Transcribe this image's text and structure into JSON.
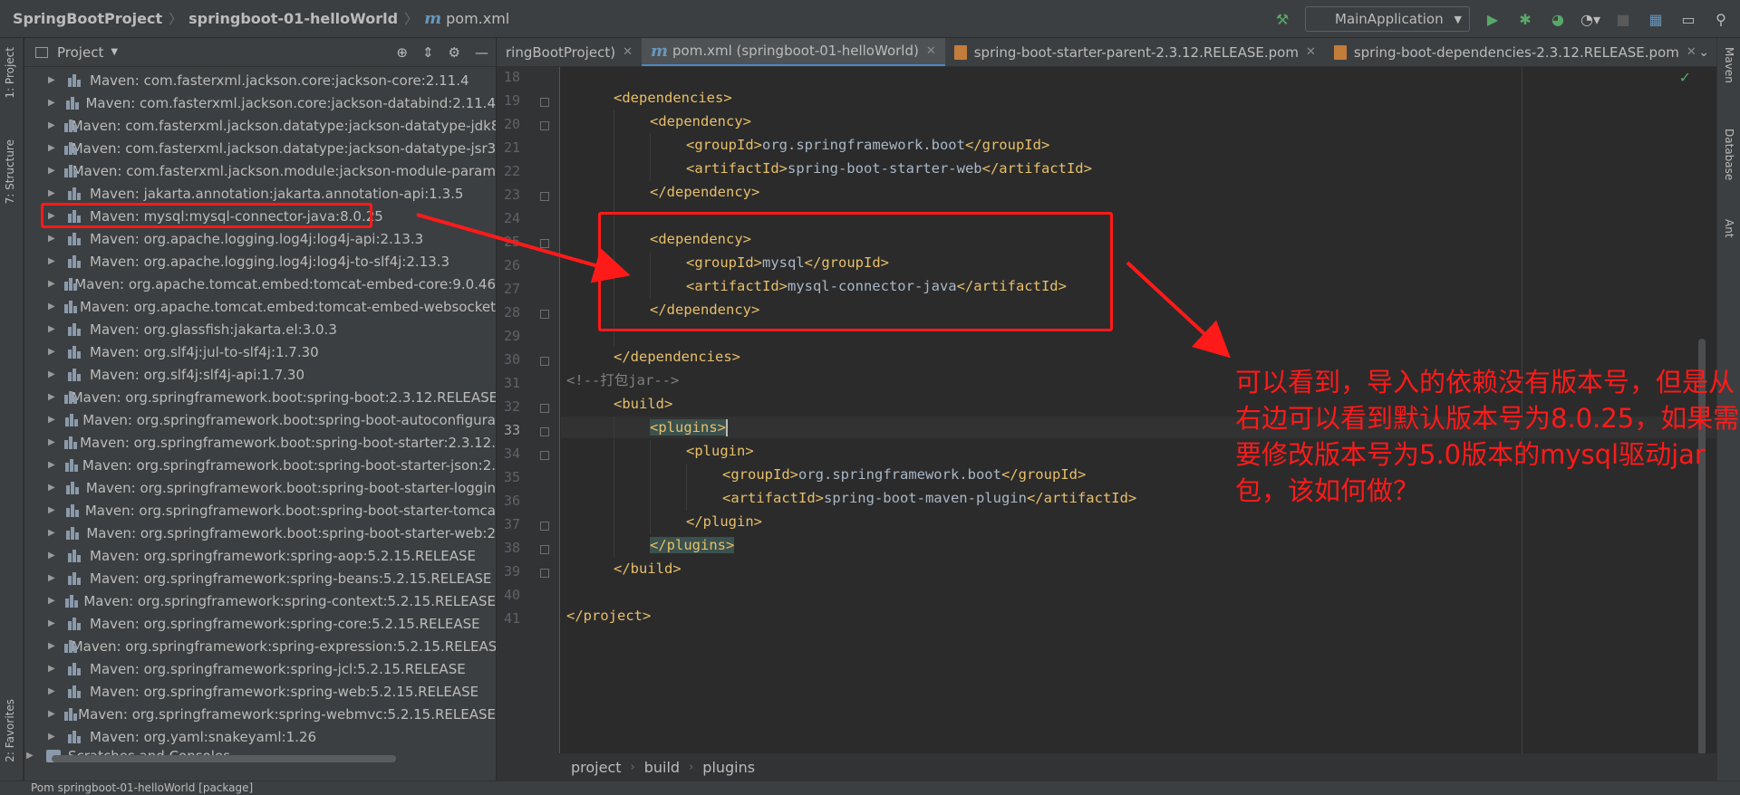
{
  "breadcrumb": {
    "project": "SpringBootProject",
    "module": "springboot-01-helloWorld",
    "file": "pom.xml"
  },
  "toolbar": {
    "run_config": "MainApplication"
  },
  "left_tabs": {
    "project": "1: Project",
    "structure": "7: Structure",
    "favorites": "2: Favorites"
  },
  "right_tabs": {
    "maven": "Maven",
    "database": "Database",
    "ant": "Ant"
  },
  "project_panel": {
    "title": "Project",
    "items": [
      "Maven: com.fasterxml.jackson.core:jackson-core:2.11.4",
      "Maven: com.fasterxml.jackson.core:jackson-databind:2.11.4",
      "Maven: com.fasterxml.jackson.datatype:jackson-datatype-jdk8",
      "Maven: com.fasterxml.jackson.datatype:jackson-datatype-jsr3",
      "Maven: com.fasterxml.jackson.module:jackson-module-param",
      "Maven: jakarta.annotation:jakarta.annotation-api:1.3.5",
      "Maven: mysql:mysql-connector-java:8.0.25",
      "Maven: org.apache.logging.log4j:log4j-api:2.13.3",
      "Maven: org.apache.logging.log4j:log4j-to-slf4j:2.13.3",
      "Maven: org.apache.tomcat.embed:tomcat-embed-core:9.0.46",
      "Maven: org.apache.tomcat.embed:tomcat-embed-websocket",
      "Maven: org.glassfish:jakarta.el:3.0.3",
      "Maven: org.slf4j:jul-to-slf4j:1.7.30",
      "Maven: org.slf4j:slf4j-api:1.7.30",
      "Maven: org.springframework.boot:spring-boot:2.3.12.RELEASE",
      "Maven: org.springframework.boot:spring-boot-autoconfigura",
      "Maven: org.springframework.boot:spring-boot-starter:2.3.12.",
      "Maven: org.springframework.boot:spring-boot-starter-json:2.",
      "Maven: org.springframework.boot:spring-boot-starter-loggin",
      "Maven: org.springframework.boot:spring-boot-starter-tomca",
      "Maven: org.springframework.boot:spring-boot-starter-web:2",
      "Maven: org.springframework:spring-aop:5.2.15.RELEASE",
      "Maven: org.springframework:spring-beans:5.2.15.RELEASE",
      "Maven: org.springframework:spring-context:5.2.15.RELEASE",
      "Maven: org.springframework:spring-core:5.2.15.RELEASE",
      "Maven: org.springframework:spring-expression:5.2.15.RELEAS",
      "Maven: org.springframework:spring-jcl:5.2.15.RELEASE",
      "Maven: org.springframework:spring-web:5.2.15.RELEASE",
      "Maven: org.springframework:spring-webmvc:5.2.15.RELEASE",
      "Maven: org.yaml:snakeyaml:1.26"
    ],
    "scratches": "Scratches and Consoles"
  },
  "editor_tabs": [
    {
      "label": "ringBootProject)"
    },
    {
      "label": "pom.xml (springboot-01-helloWorld)"
    },
    {
      "label": "spring-boot-starter-parent-2.3.12.RELEASE.pom"
    },
    {
      "label": "spring-boot-dependencies-2.3.12.RELEASE.pom"
    }
  ],
  "code": {
    "line_numbers": [
      "18",
      "19",
      "20",
      "21",
      "22",
      "23",
      "24",
      "25",
      "26",
      "27",
      "28",
      "29",
      "30",
      "31",
      "32",
      "33",
      "34",
      "35",
      "36",
      "37",
      "38",
      "39",
      "40",
      "41"
    ],
    "current_line": "33",
    "comment_text": "<!--打包jar-->"
  },
  "annotation": {
    "text": "可以看到，导入的依赖没有版本号，但是从右边可以看到默认版本号为8.0.25，如果需要修改版本号为5.0版本的mysql驱动jar包，该如何做？"
  },
  "footer_breadcrumb": [
    "project",
    "build",
    "plugins"
  ],
  "status_bar": "Pom      springboot-01-helloWorld [package]"
}
